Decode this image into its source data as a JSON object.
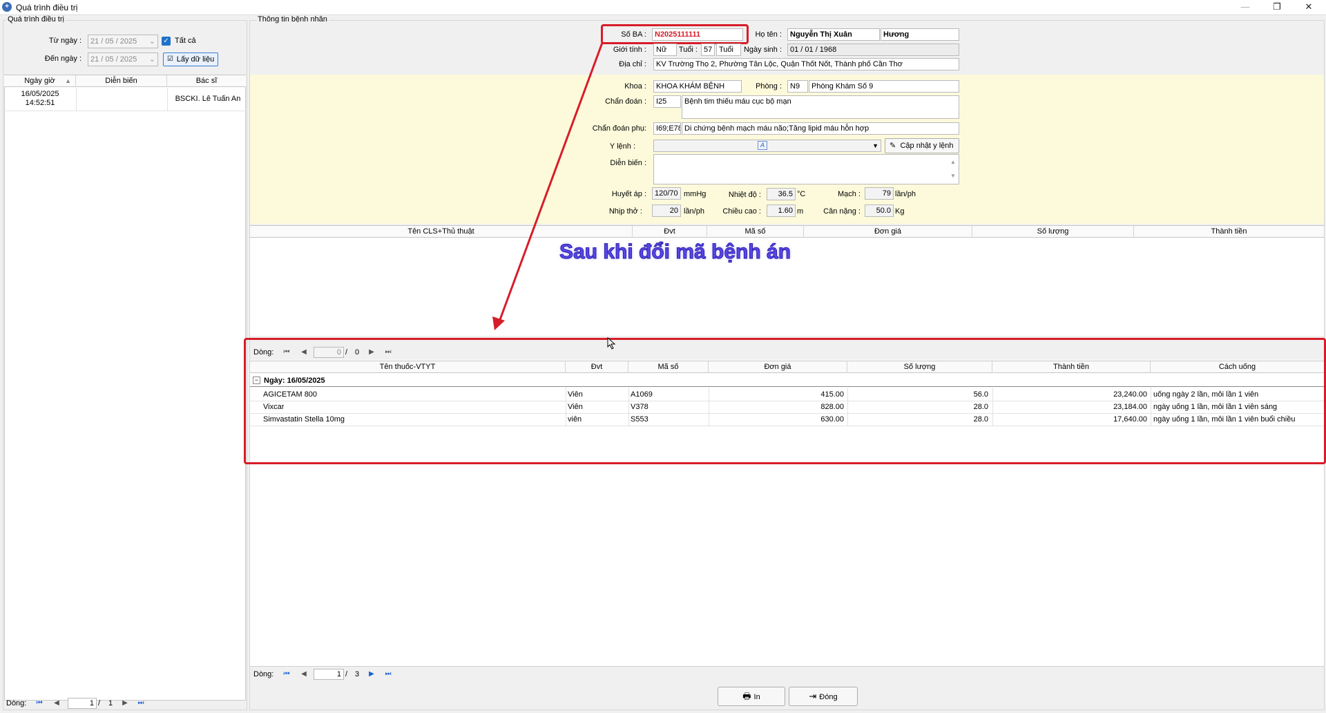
{
  "window": {
    "title": "Quá trình điều trị",
    "minimize": "—",
    "restore": "❐",
    "close": "✕"
  },
  "left": {
    "group_title": "Quá trình điều trị",
    "from_label": "Từ ngày :",
    "from_value": "21 / 05 / 2025",
    "to_label": "Đến ngày :",
    "to_value": "21 / 05 / 2025",
    "all_checkbox": "Tất cả",
    "load_button": "Lấy dữ liệu",
    "columns": [
      "Ngày giờ",
      "Diễn biến",
      "Bác sĩ"
    ],
    "rows": [
      {
        "datetime": "16/05/2025\n14:52:51",
        "date": "16/05/2025",
        "time": "14:52:51",
        "progress": "",
        "doctor": "BSCKI. Lê Tuấn An"
      }
    ],
    "pager": {
      "label": "Dòng:",
      "current": "1",
      "sep": "/",
      "total": "1"
    }
  },
  "patient": {
    "group_title": "Thông tin bệnh nhân",
    "so_ba_label": "Số BA :",
    "so_ba": "N2025111111",
    "name_label": "Họ tên :",
    "last_name": "Nguyễn Thị Xuân",
    "first_name": "Hương",
    "gender_label": "Giới tính :",
    "gender": "Nữ",
    "age_label": "Tuổi :",
    "age": "57",
    "age_unit": "Tuổi",
    "dob_label": "Ngày sinh :",
    "dob": "01 / 01 / 1968",
    "address_label": "Địa chỉ :",
    "address": "KV Trường Thọ 2, Phường Tân Lộc, Quận Thốt Nốt, Thành phố Cần Thơ",
    "dept_label": "Khoa :",
    "dept": "KHOA KHÁM BỆNH",
    "room_label": "Phòng :",
    "room_code": "N9",
    "room_name": "Phòng Khám Số 9",
    "diag_label": "Chẩn đoán :",
    "diag_code": "I25",
    "diag_text": "Bệnh tim thiếu máu cục bộ mạn",
    "subdiag_label": "Chẩn đoán phụ:",
    "subdiag_code": "I69;E78",
    "subdiag_text": "Di chứng bệnh mạch máu não;Tăng lipid máu hỗn hợp",
    "order_label": "Y lệnh :",
    "order_value": "",
    "update_button": "Cập nhật y lệnh",
    "progress_label": "Diễn biến :",
    "progress_value": "",
    "bp_label": "Huyết áp :",
    "bp": "120/70",
    "bp_unit": "mmHg",
    "temp_label": "Nhiệt độ :",
    "temp": "36.5",
    "temp_unit": "°C",
    "pulse_label": "Mạch :",
    "pulse": "79",
    "pulse_unit": "lần/ph",
    "resp_label": "Nhịp thở :",
    "resp": "20",
    "resp_unit": "lần/ph",
    "height_label": "Chiều cao :",
    "height": "1.60",
    "height_unit": "m",
    "weight_label": "Cân nặng :",
    "weight": "50.0",
    "weight_unit": "Kg"
  },
  "cls_table": {
    "columns": [
      "Tên CLS+Thủ thuật",
      "Đvt",
      "Mã số",
      "Đơn giá",
      "Số lượng",
      "Thành tiền"
    ]
  },
  "annotation": "Sau khi đổi mã bệnh án",
  "upper_pager": {
    "label": "Dòng:",
    "current": "0",
    "sep": "/",
    "total": "0"
  },
  "drug_table": {
    "columns": [
      "Tên thuốc-VTYT",
      "Đvt",
      "Mã số",
      "Đơn giá",
      "Số lượng",
      "Thành tiền",
      "Cách uống"
    ],
    "group_label": "Ngày:  16/05/2025",
    "group_toggle": "−",
    "rows": [
      {
        "name": "AGICETAM 800",
        "unit": "Viên",
        "code": "A1069",
        "price": "415.00",
        "qty": "56.0",
        "total": "23,240.00",
        "usage": "uống ngày 2 lần, mỗi lần 1 viên"
      },
      {
        "name": "Vixcar",
        "unit": "Viên",
        "code": "V378",
        "price": "828.00",
        "qty": "28.0",
        "total": "23,184.00",
        "usage": "ngày uống 1 lần, mỗi lần 1 viên sáng"
      },
      {
        "name": "Simvastatin Stella 10mg",
        "unit": "viên",
        "code": "S553",
        "price": "630.00",
        "qty": "28.0",
        "total": "17,640.00",
        "usage": "ngày uống 1 lần, mỗi lần 1 viên buổi chiều"
      }
    ]
  },
  "bottom_pager": {
    "label": "Dòng:",
    "current": "1",
    "sep": "/",
    "total": "3"
  },
  "footer": {
    "print_button": "In",
    "close_button": "Đóng"
  },
  "colors": {
    "accent_red": "#d71c28",
    "annotation_blue": "#4a3ddb",
    "yellow_panel": "#fcfadb"
  }
}
